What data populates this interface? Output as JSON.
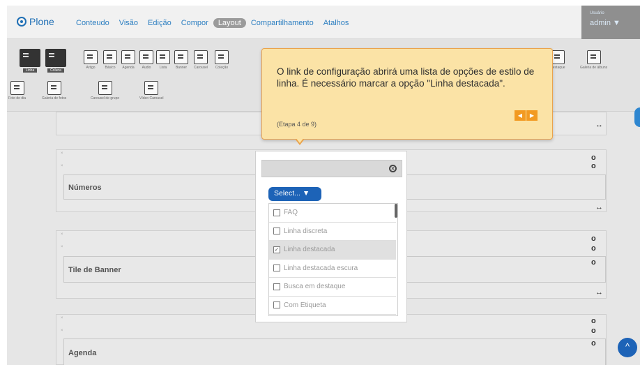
{
  "header": {
    "logo": "Plone",
    "menu": [
      "Conteudo",
      "Visão",
      "Edição",
      "Compor",
      "Layout",
      "Compartilhamento",
      "Atalhos"
    ],
    "active_menu": "Layout",
    "user_caption": "Usuário",
    "user_name": "admin ▼"
  },
  "palette": {
    "row1": [
      "Linha",
      "Coluna",
      "Artigo",
      "Básico",
      "Agenda",
      "Audio",
      "Lista",
      "Banner",
      "Carousel",
      "Coleção"
    ],
    "row1_right": [
      "destaque",
      "Galeria de álbuns"
    ],
    "row2": [
      "Foto do dia",
      "Galeria de fotos",
      "Carousel de grupo",
      "Vídeo Carousel"
    ]
  },
  "tooltip": {
    "text": "O link de configuração abrirá uma lista de opções de estilo de linha. É necessário marcar a opção \"Linha destacada\".",
    "step": "(Etapa 4 de 9)",
    "prev_icon": "chevron-left-icon",
    "next_icon": "chevron-right-icon"
  },
  "popup": {
    "select_label": "Select... ▼",
    "options": [
      {
        "label": "FAQ",
        "checked": false
      },
      {
        "label": "Linha discreta",
        "checked": false
      },
      {
        "label": "Linha destacada",
        "checked": true
      },
      {
        "label": "Linha destacada escura",
        "checked": false
      },
      {
        "label": "Busca em destaque",
        "checked": false
      },
      {
        "label": "Com Etiqueta",
        "checked": false
      }
    ]
  },
  "tiles": {
    "numeros": "Números",
    "banner": "Tile de Banner",
    "agenda": "Agenda"
  },
  "icons": {
    "move": "↔",
    "settings": "⚙",
    "up": "^"
  },
  "colors": {
    "accent": "#1d63b7",
    "tooltip_bg": "#fbe3a6",
    "tooltip_nav": "#f29a22"
  }
}
